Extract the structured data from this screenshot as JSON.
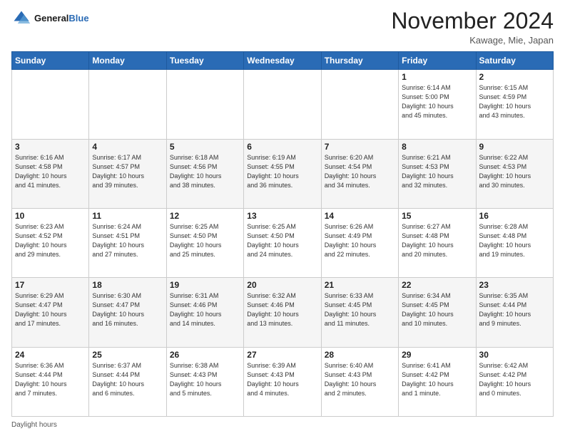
{
  "header": {
    "logo_line1": "General",
    "logo_line2": "Blue",
    "month_title": "November 2024",
    "location": "Kawage, Mie, Japan"
  },
  "footer": {
    "daylight_label": "Daylight hours"
  },
  "weekdays": [
    "Sunday",
    "Monday",
    "Tuesday",
    "Wednesday",
    "Thursday",
    "Friday",
    "Saturday"
  ],
  "weeks": [
    [
      {
        "day": "",
        "info": ""
      },
      {
        "day": "",
        "info": ""
      },
      {
        "day": "",
        "info": ""
      },
      {
        "day": "",
        "info": ""
      },
      {
        "day": "",
        "info": ""
      },
      {
        "day": "1",
        "info": "Sunrise: 6:14 AM\nSunset: 5:00 PM\nDaylight: 10 hours\nand 45 minutes."
      },
      {
        "day": "2",
        "info": "Sunrise: 6:15 AM\nSunset: 4:59 PM\nDaylight: 10 hours\nand 43 minutes."
      }
    ],
    [
      {
        "day": "3",
        "info": "Sunrise: 6:16 AM\nSunset: 4:58 PM\nDaylight: 10 hours\nand 41 minutes."
      },
      {
        "day": "4",
        "info": "Sunrise: 6:17 AM\nSunset: 4:57 PM\nDaylight: 10 hours\nand 39 minutes."
      },
      {
        "day": "5",
        "info": "Sunrise: 6:18 AM\nSunset: 4:56 PM\nDaylight: 10 hours\nand 38 minutes."
      },
      {
        "day": "6",
        "info": "Sunrise: 6:19 AM\nSunset: 4:55 PM\nDaylight: 10 hours\nand 36 minutes."
      },
      {
        "day": "7",
        "info": "Sunrise: 6:20 AM\nSunset: 4:54 PM\nDaylight: 10 hours\nand 34 minutes."
      },
      {
        "day": "8",
        "info": "Sunrise: 6:21 AM\nSunset: 4:53 PM\nDaylight: 10 hours\nand 32 minutes."
      },
      {
        "day": "9",
        "info": "Sunrise: 6:22 AM\nSunset: 4:53 PM\nDaylight: 10 hours\nand 30 minutes."
      }
    ],
    [
      {
        "day": "10",
        "info": "Sunrise: 6:23 AM\nSunset: 4:52 PM\nDaylight: 10 hours\nand 29 minutes."
      },
      {
        "day": "11",
        "info": "Sunrise: 6:24 AM\nSunset: 4:51 PM\nDaylight: 10 hours\nand 27 minutes."
      },
      {
        "day": "12",
        "info": "Sunrise: 6:25 AM\nSunset: 4:50 PM\nDaylight: 10 hours\nand 25 minutes."
      },
      {
        "day": "13",
        "info": "Sunrise: 6:25 AM\nSunset: 4:50 PM\nDaylight: 10 hours\nand 24 minutes."
      },
      {
        "day": "14",
        "info": "Sunrise: 6:26 AM\nSunset: 4:49 PM\nDaylight: 10 hours\nand 22 minutes."
      },
      {
        "day": "15",
        "info": "Sunrise: 6:27 AM\nSunset: 4:48 PM\nDaylight: 10 hours\nand 20 minutes."
      },
      {
        "day": "16",
        "info": "Sunrise: 6:28 AM\nSunset: 4:48 PM\nDaylight: 10 hours\nand 19 minutes."
      }
    ],
    [
      {
        "day": "17",
        "info": "Sunrise: 6:29 AM\nSunset: 4:47 PM\nDaylight: 10 hours\nand 17 minutes."
      },
      {
        "day": "18",
        "info": "Sunrise: 6:30 AM\nSunset: 4:47 PM\nDaylight: 10 hours\nand 16 minutes."
      },
      {
        "day": "19",
        "info": "Sunrise: 6:31 AM\nSunset: 4:46 PM\nDaylight: 10 hours\nand 14 minutes."
      },
      {
        "day": "20",
        "info": "Sunrise: 6:32 AM\nSunset: 4:46 PM\nDaylight: 10 hours\nand 13 minutes."
      },
      {
        "day": "21",
        "info": "Sunrise: 6:33 AM\nSunset: 4:45 PM\nDaylight: 10 hours\nand 11 minutes."
      },
      {
        "day": "22",
        "info": "Sunrise: 6:34 AM\nSunset: 4:45 PM\nDaylight: 10 hours\nand 10 minutes."
      },
      {
        "day": "23",
        "info": "Sunrise: 6:35 AM\nSunset: 4:44 PM\nDaylight: 10 hours\nand 9 minutes."
      }
    ],
    [
      {
        "day": "24",
        "info": "Sunrise: 6:36 AM\nSunset: 4:44 PM\nDaylight: 10 hours\nand 7 minutes."
      },
      {
        "day": "25",
        "info": "Sunrise: 6:37 AM\nSunset: 4:44 PM\nDaylight: 10 hours\nand 6 minutes."
      },
      {
        "day": "26",
        "info": "Sunrise: 6:38 AM\nSunset: 4:43 PM\nDaylight: 10 hours\nand 5 minutes."
      },
      {
        "day": "27",
        "info": "Sunrise: 6:39 AM\nSunset: 4:43 PM\nDaylight: 10 hours\nand 4 minutes."
      },
      {
        "day": "28",
        "info": "Sunrise: 6:40 AM\nSunset: 4:43 PM\nDaylight: 10 hours\nand 2 minutes."
      },
      {
        "day": "29",
        "info": "Sunrise: 6:41 AM\nSunset: 4:42 PM\nDaylight: 10 hours\nand 1 minute."
      },
      {
        "day": "30",
        "info": "Sunrise: 6:42 AM\nSunset: 4:42 PM\nDaylight: 10 hours\nand 0 minutes."
      }
    ]
  ]
}
